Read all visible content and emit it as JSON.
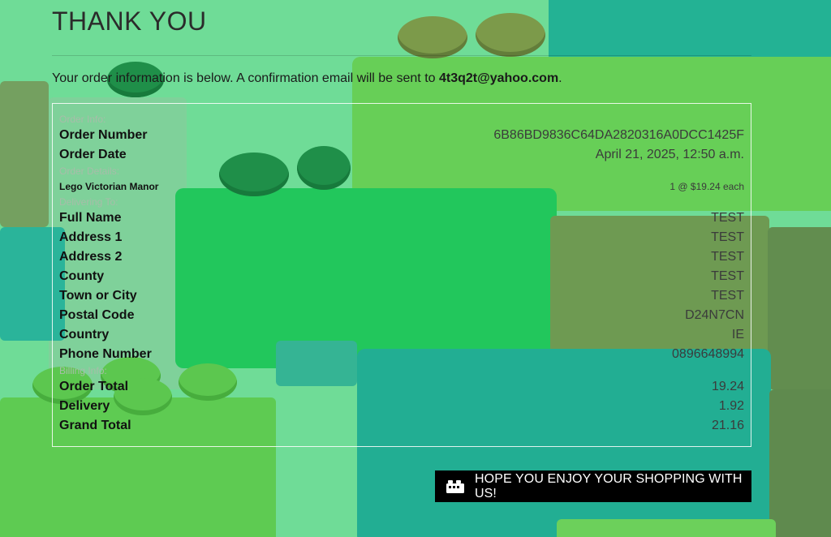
{
  "page": {
    "title": "THANK YOU",
    "intro_text": "Your order information is below. A confirmation email will be sent to ",
    "email": "4t3q2t@yahoo.com",
    "intro_end": "."
  },
  "order_info": {
    "label": "Order Info:",
    "rows": [
      {
        "key": "Order Number",
        "value": "6B86BD9836C64DA2820316A0DCC1425F"
      },
      {
        "key": "Order Date",
        "value": "April 21, 2025, 12:50 a.m."
      }
    ]
  },
  "order_details": {
    "label": "Order Details:",
    "items": [
      {
        "name": "Lego Victorian Manor",
        "qty_price": "1 @ $19.24 each"
      }
    ]
  },
  "delivering_to": {
    "label": "Delivering To:",
    "rows": [
      {
        "key": "Full Name",
        "value": "TEST"
      },
      {
        "key": "Address 1",
        "value": "TEST"
      },
      {
        "key": "Address 2",
        "value": "TEST"
      },
      {
        "key": "County",
        "value": "TEST"
      },
      {
        "key": "Town or City",
        "value": "TEST"
      },
      {
        "key": "Postal Code",
        "value": "D24N7CN"
      },
      {
        "key": "Country",
        "value": "IE"
      },
      {
        "key": "Phone Number",
        "value": "0896648994"
      }
    ]
  },
  "billing_info": {
    "label": "Billing Info:",
    "rows": [
      {
        "key": "Order Total",
        "value": "19.24"
      },
      {
        "key": "Delivery",
        "value": "1.92"
      },
      {
        "key": "Grand Total",
        "value": "21.16"
      }
    ]
  },
  "cta": {
    "icon": "lego-brick-icon",
    "label": "HOPE YOU ENJOY YOUR SHOPPING WITH US!"
  },
  "colors": {
    "background": "#6fdc97",
    "button": "#000000",
    "button_text": "#ffffff"
  }
}
